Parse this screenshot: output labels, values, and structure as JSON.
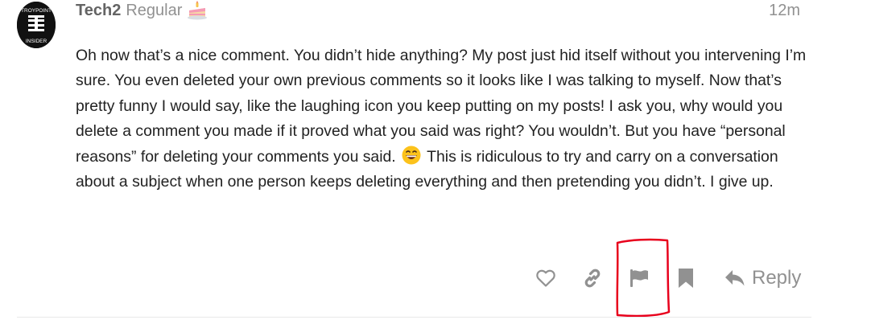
{
  "post": {
    "avatar": {
      "top_text": "TROYPOINT",
      "bottom_text": "INSIDER"
    },
    "username": "Tech2",
    "user_title": "Regular",
    "badge_icon": "cake-icon",
    "timestamp": "12m",
    "body": {
      "text_before_emoji": "Oh now that’s a nice comment. You didn’t hide anything? My post just hid itself without you intervening I’m sure. You even deleted your own previous comments so it looks like I was talking to myself. Now that’s pretty funny I would say, like the laughing icon you keep putting on my posts! I ask you, why would you delete a comment you made if it proved what you said was right? You wouldn’t. But you have “personal reasons” for deleting your comments you said.",
      "emoji": "grinning-face-emoji",
      "text_after_emoji": "This is ridiculous to try and carry on a conversation about a subject when one person keeps deleting everything and then pretending you didn’t. I give up."
    },
    "actions": {
      "like_icon": "heart-icon",
      "link_icon": "link-icon",
      "flag_icon": "flag-icon",
      "bookmark_icon": "bookmark-icon",
      "reply_icon": "reply-arrow-icon",
      "reply_label": "Reply"
    },
    "annotation": {
      "highlight_color": "#e8001c",
      "highlighted_target": "flag-button"
    },
    "colors": {
      "icon_gray": "#919191",
      "text": "#222222",
      "username": "#646464"
    }
  }
}
